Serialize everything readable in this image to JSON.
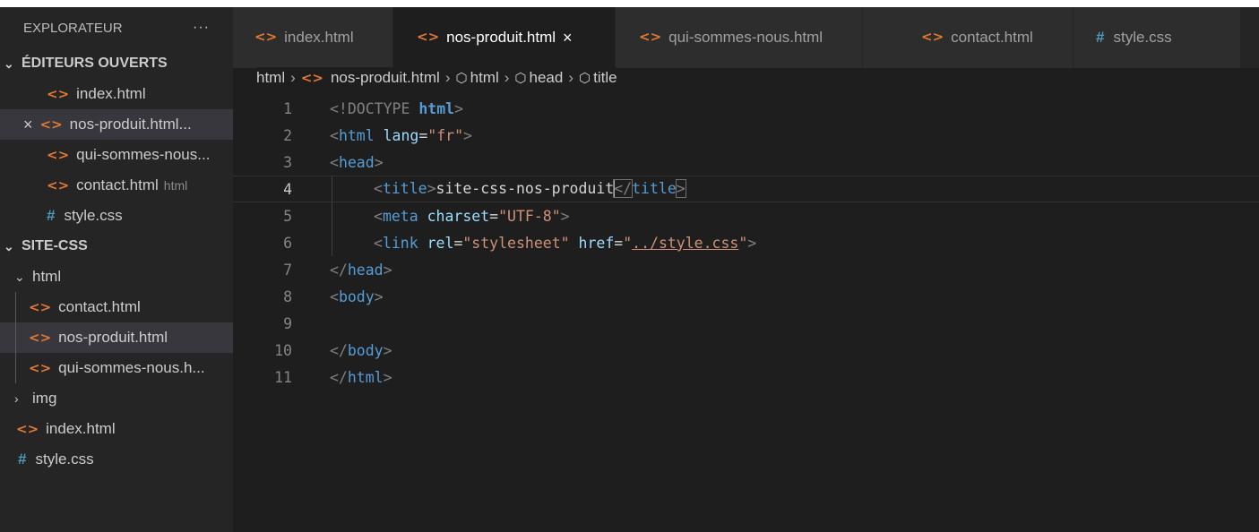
{
  "sidebar": {
    "title": "EXPLORATEUR",
    "more": "···",
    "open_editors_title": "ÉDITEURS OUVERTS",
    "open_editors": [
      {
        "icon": "html-file-icon",
        "name": "index.html",
        "extra": ""
      },
      {
        "icon": "html-file-icon",
        "name": "nos-produit.html...",
        "extra": "",
        "close": "×"
      },
      {
        "icon": "html-file-icon",
        "name": "qui-sommes-nous...",
        "extra": ""
      },
      {
        "icon": "html-file-icon",
        "name": "contact.html",
        "extra": "html"
      },
      {
        "icon": "css-file-icon",
        "name": "style.css",
        "extra": ""
      }
    ],
    "workspace_title": "SITE-CSS",
    "tree": {
      "html_folder": "html",
      "html_files": [
        "contact.html",
        "nos-produit.html",
        "qui-sommes-nous.h..."
      ],
      "img_folder": "img",
      "root_files": [
        "index.html",
        "style.css"
      ]
    },
    "chevron_down": "⌄",
    "chevron_right": "›"
  },
  "tabs": [
    {
      "name": "index.html",
      "icon": "html-file-icon"
    },
    {
      "name": "nos-produit.html",
      "icon": "html-file-icon",
      "close": "×"
    },
    {
      "name": "qui-sommes-nous.html",
      "icon": "html-file-icon"
    },
    {
      "name": "contact.html",
      "icon": "html-file-icon"
    },
    {
      "name": "style.css",
      "icon": "css-file-icon"
    }
  ],
  "breadcrumb": [
    "html",
    "nos-produit.html",
    "html",
    "head",
    "title"
  ],
  "editor": {
    "line_numbers": [
      "1",
      "2",
      "3",
      "4",
      "5",
      "6",
      "7",
      "8",
      "9",
      "10",
      "11"
    ],
    "current_line": "4",
    "l1": {
      "open": "<!DOCTYPE ",
      "kw": "html",
      "close": ">"
    },
    "l2": {
      "lt": "<",
      "tag": "html",
      "attr": " lang",
      "eq": "=",
      "val": "\"fr\"",
      "gt": ">"
    },
    "l3": {
      "lt": "<",
      "tag": "head",
      "gt": ">"
    },
    "l4": {
      "lt": "<",
      "tag": "title",
      "gt": ">",
      "text": "site-css-nos-produit",
      "lt2": "</",
      "tag2": "title",
      "gt2": ">"
    },
    "l5": {
      "lt": "<",
      "tag": "meta",
      "attr": " charset",
      "eq": "=",
      "val": "\"UTF-8\"",
      "gt": ">"
    },
    "l6": {
      "lt": "<",
      "tag": "link",
      "attr1": " rel",
      "eq1": "=",
      "val1": "\"stylesheet\"",
      "attr2": " href",
      "eq2": "=",
      "q1": "\"",
      "link": "../style.css",
      "q2": "\"",
      "gt": ">"
    },
    "l7": {
      "lt": "</",
      "tag": "head",
      "gt": ">"
    },
    "l8": {
      "lt": "<",
      "tag": "body",
      "gt": ">"
    },
    "l10": {
      "lt": "</",
      "tag": "body",
      "gt": ">"
    },
    "l11": {
      "lt": "</",
      "tag": "html",
      "gt": ">"
    }
  },
  "icons": {
    "html": "<>",
    "css": "#",
    "close": "×",
    "cube": "⬡",
    "breadcrumb_sep": "›"
  },
  "colors": {
    "html_icon": "#e37933",
    "css_icon": "#519aba",
    "tag": "#569cd6",
    "attr": "#9cdcfe",
    "string": "#ce9178"
  }
}
